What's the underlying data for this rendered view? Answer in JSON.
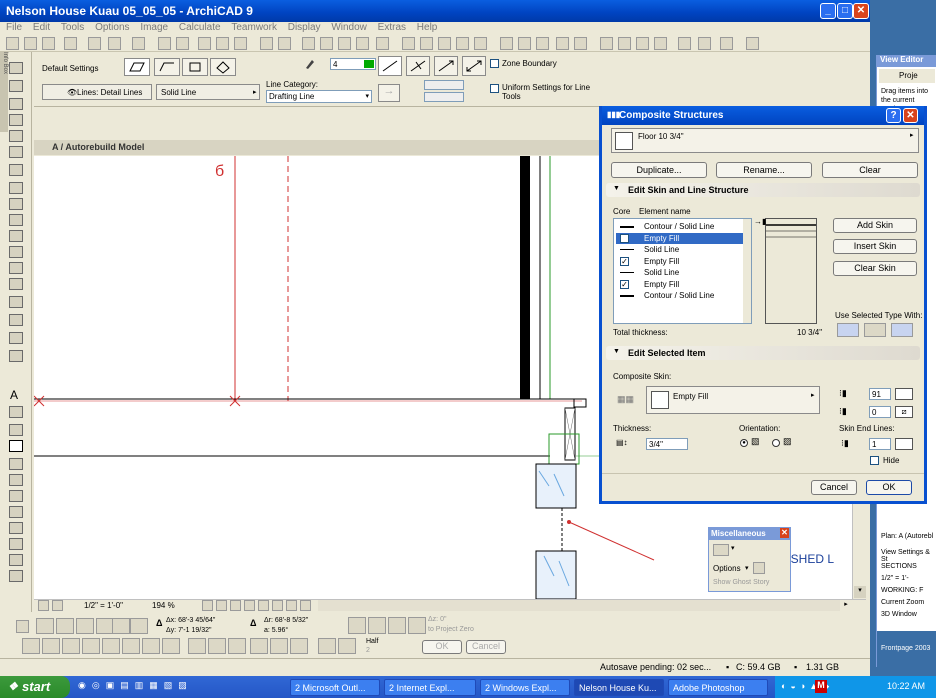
{
  "window": {
    "title": "Nelson House Kuau 05_05_05 - ArchiCAD 9",
    "min_label": "_",
    "max_label": "□",
    "close_label": "✕"
  },
  "menu": [
    "File",
    "Edit",
    "Tools",
    "Options",
    "Image",
    "Calculate",
    "Teamwork",
    "Display",
    "Window",
    "Extras",
    "Help"
  ],
  "infobox": {
    "side_label": "Info Box",
    "default_settings": "Default Settings",
    "lines_label": "Lines: Detail Lines",
    "solid_line": "Solid Line",
    "line_category_label": "Line Category:",
    "line_category_value": "Drafting Line",
    "pen_value": "4",
    "zone_boundary": "Zone Boundary",
    "uniform_settings": "Uniform Settings for Line Tools"
  },
  "drawing": {
    "title": "A  / Autorebuild Model",
    "annotation": "DASHED L",
    "scale_value": "1/2\"  =  1'-0\"",
    "zoom_value": "194 %"
  },
  "bottom": {
    "dx": "Δx: 68'-3 45/64\"",
    "dy": "Δy: 7'-1 19/32\"",
    "dr": "Δr: 68'-8 5/32\"",
    "da": "a: 5.96°",
    "dz": "Δz: 0\"",
    "project_zero": "to Project Zero",
    "half_label": "Half",
    "half_value": "2",
    "ok": "OK",
    "cancel": "Cancel"
  },
  "status": {
    "autosave": "Autosave pending: 02 sec...",
    "disk": "C: 59.4 GB",
    "ram": "1.31 GB"
  },
  "composite": {
    "title": "Composite Structures",
    "help_label": "?",
    "close_label": "✕",
    "structure_name": "Floor 10 3/4\"",
    "duplicate": "Duplicate...",
    "rename": "Rename...",
    "clear": "Clear",
    "section1": "Edit Skin and Line Structure",
    "col_core": "Core",
    "col_element": "Element name",
    "rows": [
      {
        "core": "line",
        "name": "Contour /  Solid Line"
      },
      {
        "core": "check",
        "name": "Empty Fill",
        "selected": true
      },
      {
        "core": "thin",
        "name": "Solid Line"
      },
      {
        "core": "check",
        "name": "Empty Fill"
      },
      {
        "core": "thin",
        "name": "Solid Line"
      },
      {
        "core": "check",
        "name": "Empty Fill"
      },
      {
        "core": "line",
        "name": "Contour /  Solid Line"
      }
    ],
    "add_skin": "Add Skin",
    "insert_skin": "Insert Skin",
    "clear_skin": "Clear Skin",
    "use_selected": "Use Selected Type With:",
    "total_thickness_label": "Total thickness:",
    "total_thickness_value": "10 3/4\"",
    "section2": "Edit Selected Item",
    "composite_skin_label": "Composite Skin:",
    "composite_skin_value": "Empty Fill",
    "pen1": "91",
    "pen2": "0",
    "thickness_label": "Thickness:",
    "thickness_value": "3/4\"",
    "orientation_label": "Orientation:",
    "skin_end_lines_label": "Skin End Lines:",
    "skin_end_pen": "1",
    "hide": "Hide",
    "cancel": "Cancel",
    "ok": "OK"
  },
  "misc": {
    "title": "Miscellaneous",
    "options": "Options",
    "show_ghost": "Show Ghost Story"
  },
  "right_window": {
    "title": "View Editor",
    "tab": "Proje",
    "hint": "Drag items into the current Settings.",
    "plan_label": "Plan: A (Autorebl",
    "view_settings": "View Settings & St",
    "items": [
      "SECTIONS",
      "1/2\"  =  1'-",
      "WORKING: F",
      "Current Zoom",
      "3D Window"
    ],
    "frontpage": "Frontpage 2003"
  },
  "taskbar": {
    "start": "start",
    "tasks": [
      "2 Microsoft Outl...",
      "2 Internet Expl...",
      "2 Windows Expl...",
      "Nelson House Ku...",
      "Adobe Photoshop"
    ],
    "time": "10:22 AM"
  },
  "colors": {
    "xp_blue": "#0043c0",
    "selection": "#316ac5",
    "red_line": "#d03030",
    "green_line": "#2a9a2a",
    "blue_hatch": "#6aa8e0"
  }
}
